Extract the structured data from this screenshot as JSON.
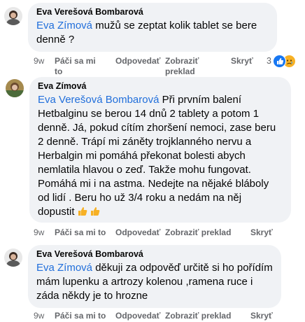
{
  "comments": [
    {
      "author": "Eva Verešová Bombarová",
      "mention": "Eva Zímová",
      "text_line1_rest": "mužů se zeptat kolik tablet se bere",
      "text_line2": "denně ?",
      "meta": {
        "time": "9w",
        "like": "Páči sa mi to",
        "reply": "Odpovedať",
        "see_translation": "Zobraziť preklad",
        "hide": "Skryť",
        "reactions_count": "3"
      }
    },
    {
      "author": "Eva Zímová",
      "mention": "Eva Verešová Bombarová",
      "lines": [
        "Při prvním balení",
        "Hetbalginu se berou 14 dnů 2 tablety a potom 1",
        "denně. Já, pokud cítím zhoršení nemoci, zase beru",
        "2 denně. Trápí mi záněty trojklanného nervu a",
        "Herbalgin mi pomáhá překonat bolesti abych",
        "nemlatila hlavou o zeď. Takže mohu fungovat.",
        "Pomáhá mi i na astma. Nedejte na nějaké bláboly",
        "od lidí . Beru ho už 3/4 roku a nedám na něj",
        "dopustit"
      ],
      "meta": {
        "time": "9w",
        "like": "Páči sa mi to",
        "reply": "Odpovedať",
        "see_translation": "Zobraziť preklad",
        "hide": "Skryť"
      }
    },
    {
      "author": "Eva Verešová Bombarová",
      "mention": "Eva Zímová",
      "text_line1_rest": "děkuji za odpověď určitě si ho pořídím",
      "lines": [
        "mám lupenku a artrozy kolenou ,ramena ruce i",
        "záda někdy je to hrozne"
      ],
      "meta": {
        "time": "9w",
        "like": "Páči sa mi to",
        "reply": "Odpovedať",
        "see_translation": "Zobraziť preklad",
        "hide": "Skryť"
      }
    }
  ],
  "icons": [
    "avatar",
    "like-reaction-icon",
    "sad-reaction-icon",
    "thumbs-up-emoji"
  ],
  "colors": {
    "mention": "#216fdb",
    "bubble": "#f0f2f5",
    "meta": "#65676b"
  }
}
